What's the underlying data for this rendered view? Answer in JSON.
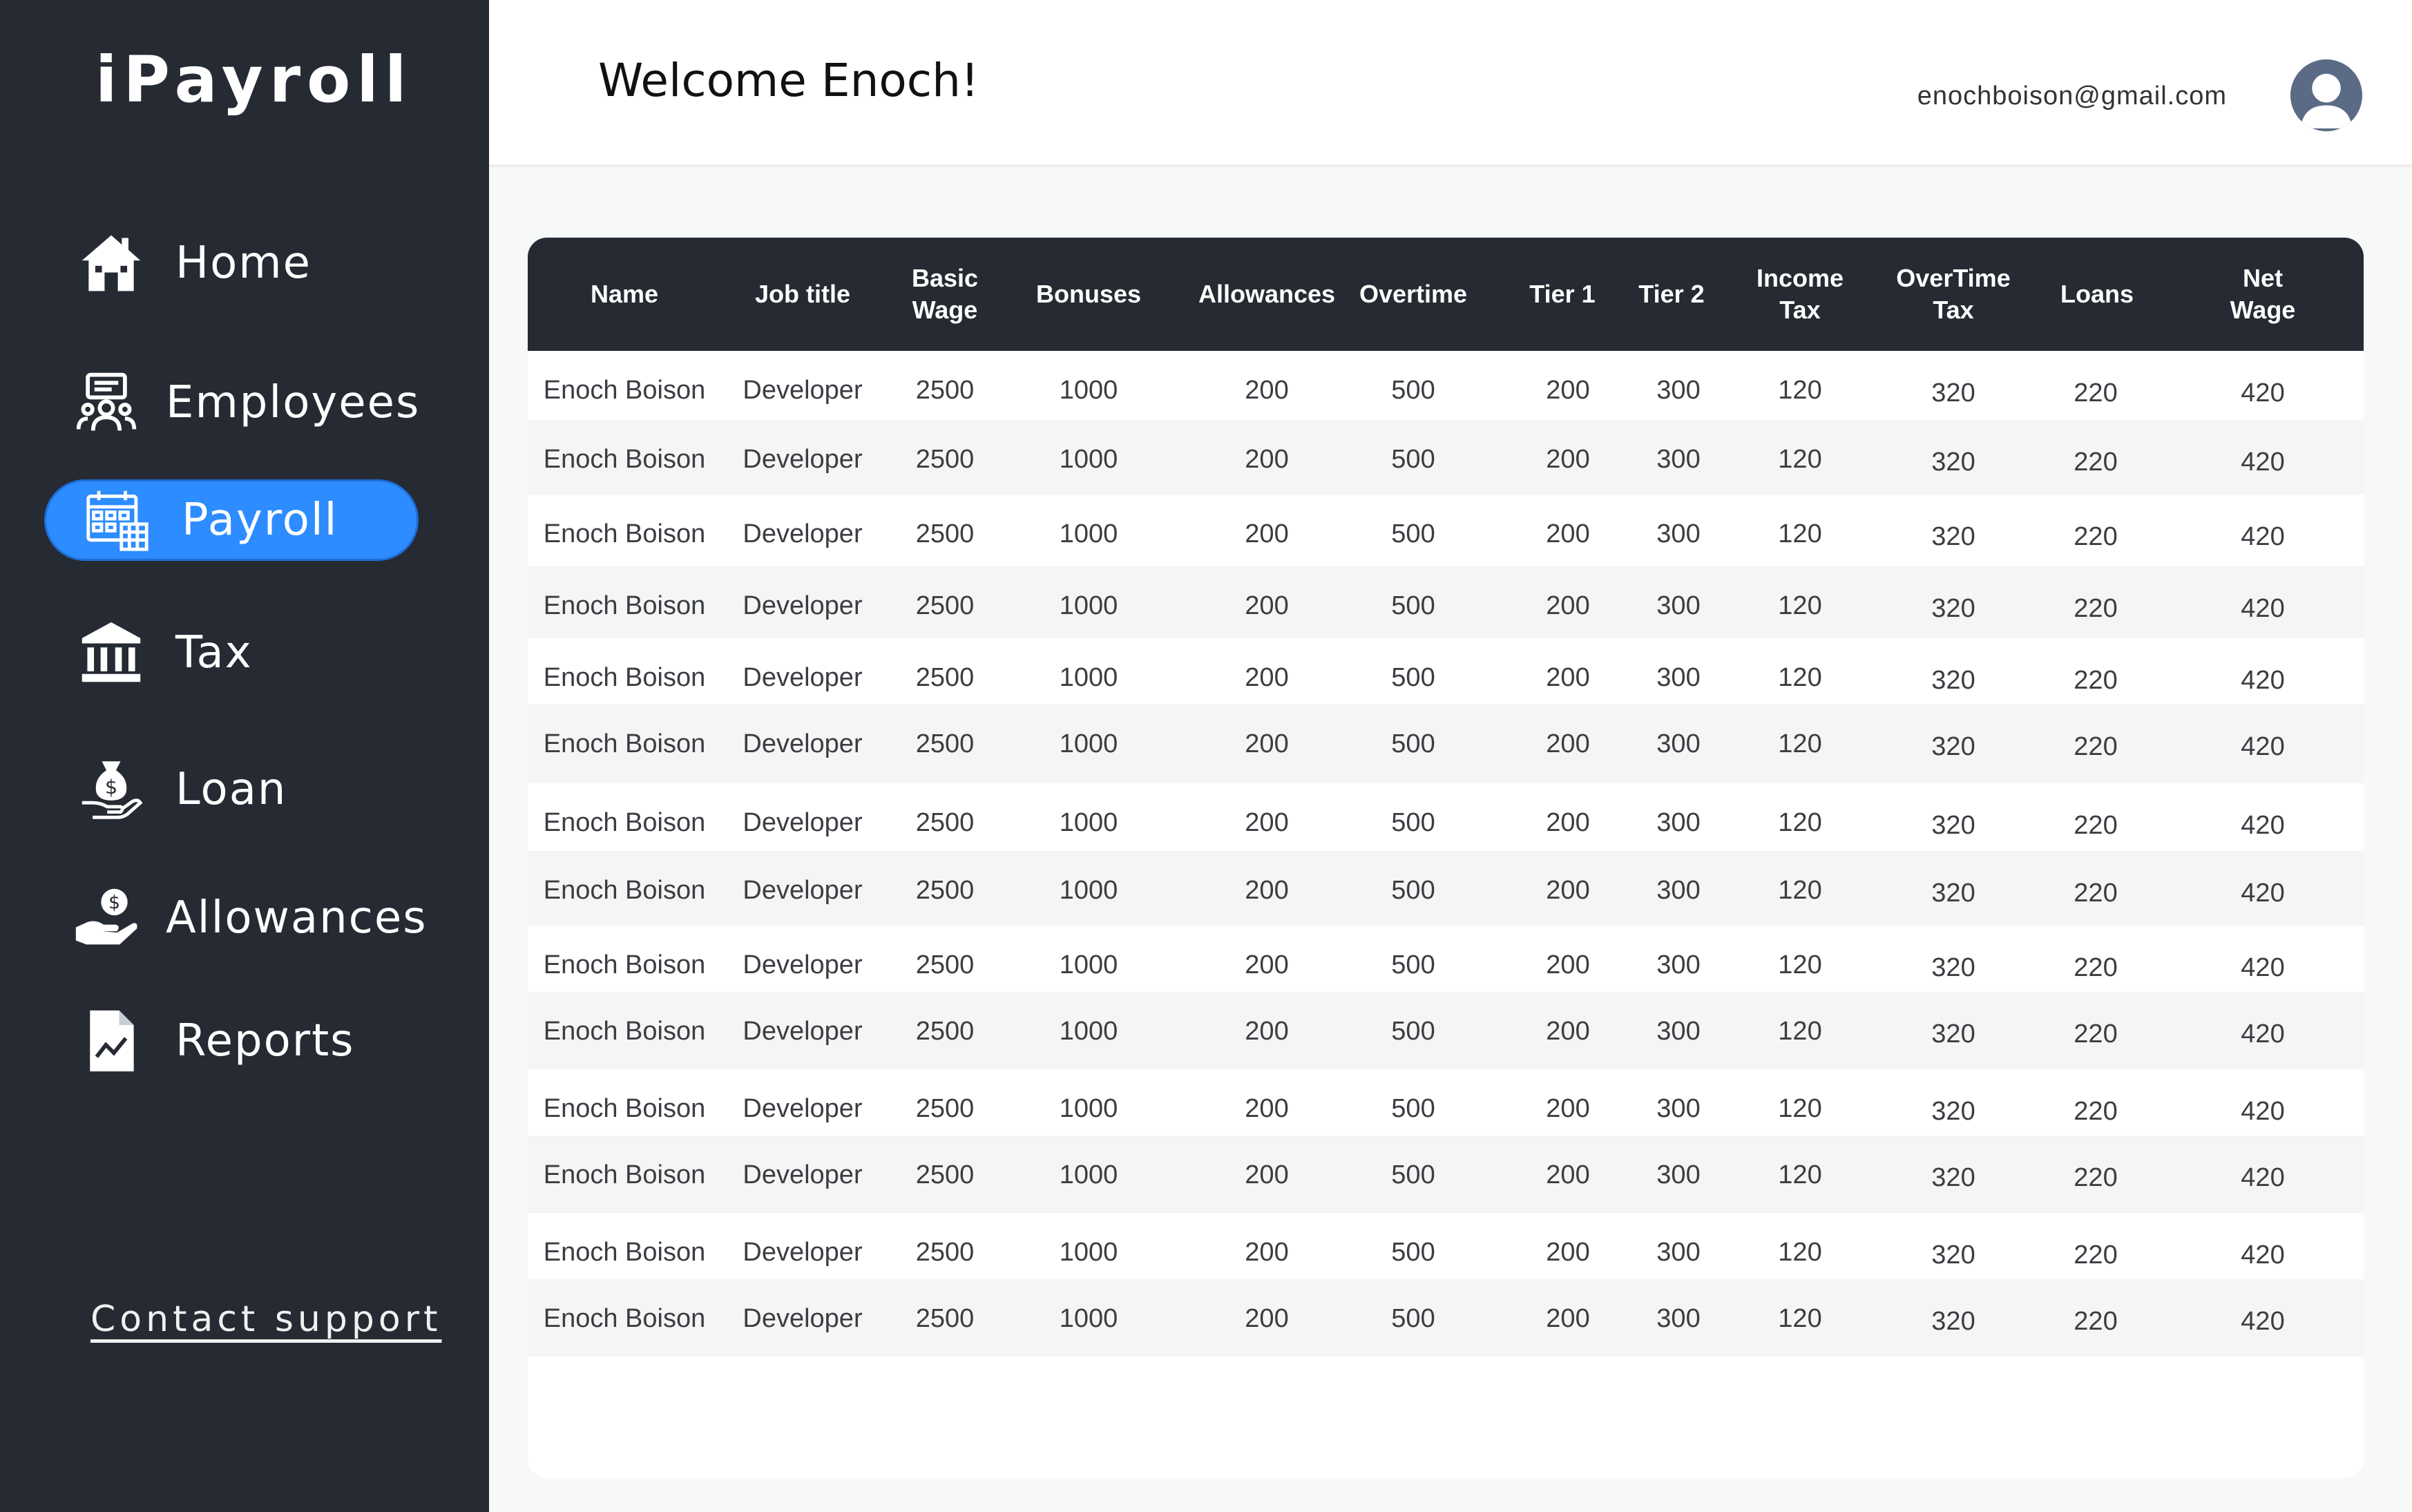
{
  "app": {
    "logo": "iPayroll"
  },
  "sidebar": {
    "items": [
      {
        "label": "Home",
        "icon": "home-icon"
      },
      {
        "label": "Employees",
        "icon": "employees-icon"
      },
      {
        "label": "Payroll",
        "icon": "calendar-icon",
        "active": true
      },
      {
        "label": "Tax",
        "icon": "bank-icon"
      },
      {
        "label": "Loan",
        "icon": "money-bag-hand-icon"
      },
      {
        "label": "Allowances",
        "icon": "coin-hand-icon"
      },
      {
        "label": "Reports",
        "icon": "report-chart-icon"
      }
    ],
    "contact_support": "Contact support"
  },
  "header": {
    "welcome": "Welcome Enoch!",
    "email": "enochboison@gmail.com"
  },
  "colors": {
    "sidebar_bg": "#262a33",
    "active_item": "#2d8cff",
    "table_header_bg": "#262a33"
  },
  "table": {
    "columns": [
      "Name",
      "Job title",
      "Basic\nWage",
      "Bonuses",
      "Allowances",
      "Overtime",
      "Tier 1",
      "Tier 2",
      "Income\nTax",
      "OverTime\nTax",
      "Loans",
      "Net\nWage"
    ],
    "rows": [
      [
        "Enoch Boison",
        "Developer",
        "2500",
        "1000",
        "200",
        "500",
        "200",
        "300",
        "120",
        "320",
        "220",
        "420"
      ],
      [
        "Enoch Boison",
        "Developer",
        "2500",
        "1000",
        "200",
        "500",
        "200",
        "300",
        "120",
        "320",
        "220",
        "420"
      ],
      [
        "Enoch Boison",
        "Developer",
        "2500",
        "1000",
        "200",
        "500",
        "200",
        "300",
        "120",
        "320",
        "220",
        "420"
      ],
      [
        "Enoch Boison",
        "Developer",
        "2500",
        "1000",
        "200",
        "500",
        "200",
        "300",
        "120",
        "320",
        "220",
        "420"
      ],
      [
        "Enoch Boison",
        "Developer",
        "2500",
        "1000",
        "200",
        "500",
        "200",
        "300",
        "120",
        "320",
        "220",
        "420"
      ],
      [
        "Enoch Boison",
        "Developer",
        "2500",
        "1000",
        "200",
        "500",
        "200",
        "300",
        "120",
        "320",
        "220",
        "420"
      ],
      [
        "Enoch Boison",
        "Developer",
        "2500",
        "1000",
        "200",
        "500",
        "200",
        "300",
        "120",
        "320",
        "220",
        "420"
      ],
      [
        "Enoch Boison",
        "Developer",
        "2500",
        "1000",
        "200",
        "500",
        "200",
        "300",
        "120",
        "320",
        "220",
        "420"
      ],
      [
        "Enoch Boison",
        "Developer",
        "2500",
        "1000",
        "200",
        "500",
        "200",
        "300",
        "120",
        "320",
        "220",
        "420"
      ],
      [
        "Enoch Boison",
        "Developer",
        "2500",
        "1000",
        "200",
        "500",
        "200",
        "300",
        "120",
        "320",
        "220",
        "420"
      ],
      [
        "Enoch Boison",
        "Developer",
        "2500",
        "1000",
        "200",
        "500",
        "200",
        "300",
        "120",
        "320",
        "220",
        "420"
      ],
      [
        "Enoch Boison",
        "Developer",
        "2500",
        "1000",
        "200",
        "500",
        "200",
        "300",
        "120",
        "320",
        "220",
        "420"
      ],
      [
        "Enoch Boison",
        "Developer",
        "2500",
        "1000",
        "200",
        "500",
        "200",
        "300",
        "120",
        "320",
        "220",
        "420"
      ],
      [
        "Enoch Boison",
        "Developer",
        "2500",
        "1000",
        "200",
        "500",
        "200",
        "300",
        "120",
        "320",
        "220",
        "420"
      ]
    ]
  }
}
